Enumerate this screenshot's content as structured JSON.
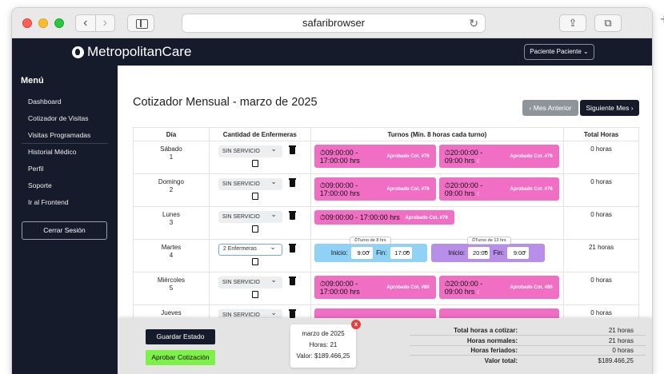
{
  "browser": {
    "url": "safaribrowser",
    "reload_icon": "↻",
    "share_icon": "⇪",
    "tabs_icon": "⧉",
    "new_tab_icon": "+",
    "back_icon": "‹",
    "forward_icon": "›"
  },
  "header": {
    "brand": "MetropolitanCare",
    "user_menu": "Paciente Paciente ⌄"
  },
  "sidebar": {
    "title": "Menú",
    "items": [
      "Dashboard",
      "Cotizador de Visitas",
      "Visitas Programadas",
      "Historial Médico",
      "Perfil",
      "Soporte",
      "Ir al Frontend"
    ],
    "logout": "Cerrar Sesión"
  },
  "main": {
    "title": "Cotizador Mensual - marzo de 2025",
    "prev_label": "‹ Mes Anterior",
    "next_label": "Siguiente Mes ›",
    "columns": [
      "Día",
      "Cantidad de Enfermeras",
      "Turnos (Min. 8 horas cada turno)",
      "Total Horas"
    ],
    "rows": [
      {
        "day": "Sábado",
        "num": "1",
        "qty": "SIN SERVICIO",
        "total": "0 horas",
        "shift_a": "⏱09:00:00 -",
        "shift_a2": "17:00:00 hrs",
        "tag_a": "Aprobado Cot. #76",
        "shift_b": "⏱20:00:00 -",
        "shift_b2": "09:00 hrs",
        "tag_b": "Aprobado Cot. #76"
      },
      {
        "day": "Domingo",
        "num": "2",
        "qty": "SIN SERVICIO",
        "total": "0 horas",
        "shift_a": "⏱09:00:00 -",
        "shift_a2": "17:00:00 hrs",
        "tag_a": "Aprobado Cot. #76",
        "shift_b": "⏱20:00:00 -",
        "shift_b2": "09:00 hrs",
        "tag_b": "Aprobado Cot. #76"
      },
      {
        "day": "Lunes",
        "num": "3",
        "qty": "SIN SERVICIO",
        "total": "0 horas",
        "shift_single": "⏱09:00:00 - 17:00:00 hrs",
        "tag_single": "Aprobado Cot. #79"
      },
      {
        "day": "Martes",
        "num": "4",
        "qty": "2 Enfermeras",
        "total": "21 horas",
        "blue_caption": "⏱Turno de 8 hrs",
        "purple_caption": "⏱Turno de 13 hrs",
        "start_label": "Inicio:",
        "end_label": "Fin:",
        "blue_start": "9:00",
        "blue_end": "17:00",
        "purple_start": "20:00",
        "purple_end": "9:00"
      },
      {
        "day": "Miércoles",
        "num": "5",
        "qty": "SIN SERVICIO",
        "total": "0 horas",
        "shift_a": "⏱09:00:00 -",
        "shift_a2": "17:00:00 hrs",
        "tag_a": "Aprobado Cot. #80",
        "shift_b": "⏱20:00:00 -",
        "shift_b2": "09:00 hrs",
        "tag_b": "Aprobado Cot. #80"
      },
      {
        "day": "Jueves",
        "qty": "SIN SERVICIO",
        "total": "0 horas"
      }
    ]
  },
  "summary": {
    "save_label": "Guardar Estado",
    "approve_label": "Aprobar Cotización",
    "card_month": "marzo de 2025",
    "card_hours": "Horas: 21",
    "card_value": "Valor: $189.466,25",
    "card_close": "x",
    "total_to_quote_label": "Total horas a cotizar:",
    "total_to_quote": "21 horas",
    "normal_hours_label": "Horas normales:",
    "normal_hours": "21 horas",
    "holiday_hours_label": "Horas feriados:",
    "holiday_hours": "0 horas",
    "total_value_label": "Valor total:",
    "total_value": "$189.466,25"
  }
}
